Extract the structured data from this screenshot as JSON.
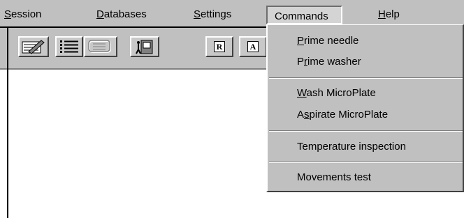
{
  "menubar": {
    "session": {
      "hotkey": "S",
      "rest": "ession"
    },
    "databases": {
      "hotkey": "D",
      "rest": "atabases"
    },
    "settings": {
      "hotkey": "S",
      "rest": "ettings"
    },
    "commands": {
      "label": "Commands"
    },
    "help": {
      "hotkey": "H",
      "rest": "elp"
    }
  },
  "toolbar": {
    "buttons": [
      {
        "icon": "edit-icon"
      },
      {
        "icon": "list-icon"
      },
      {
        "icon": "disabled-view-icon"
      },
      {
        "icon": "exit-door-icon"
      },
      {
        "icon": "r-letter-icon",
        "letter": "R"
      },
      {
        "icon": "a-letter-icon",
        "letter": "A"
      }
    ]
  },
  "commands_menu": {
    "items": [
      {
        "pre": "",
        "hotkey": "P",
        "post": "rime needle"
      },
      {
        "pre": "P",
        "hotkey": "r",
        "post": "ime washer"
      },
      {
        "pre": "",
        "hotkey": "W",
        "post": "ash MicroPlate"
      },
      {
        "pre": "A",
        "hotkey": "s",
        "post": "pirate MicroPlate"
      },
      {
        "pre": "",
        "hotkey": "",
        "post": "Temperature inspection"
      },
      {
        "pre": "",
        "hotkey": "",
        "post": "Movements test"
      }
    ]
  }
}
